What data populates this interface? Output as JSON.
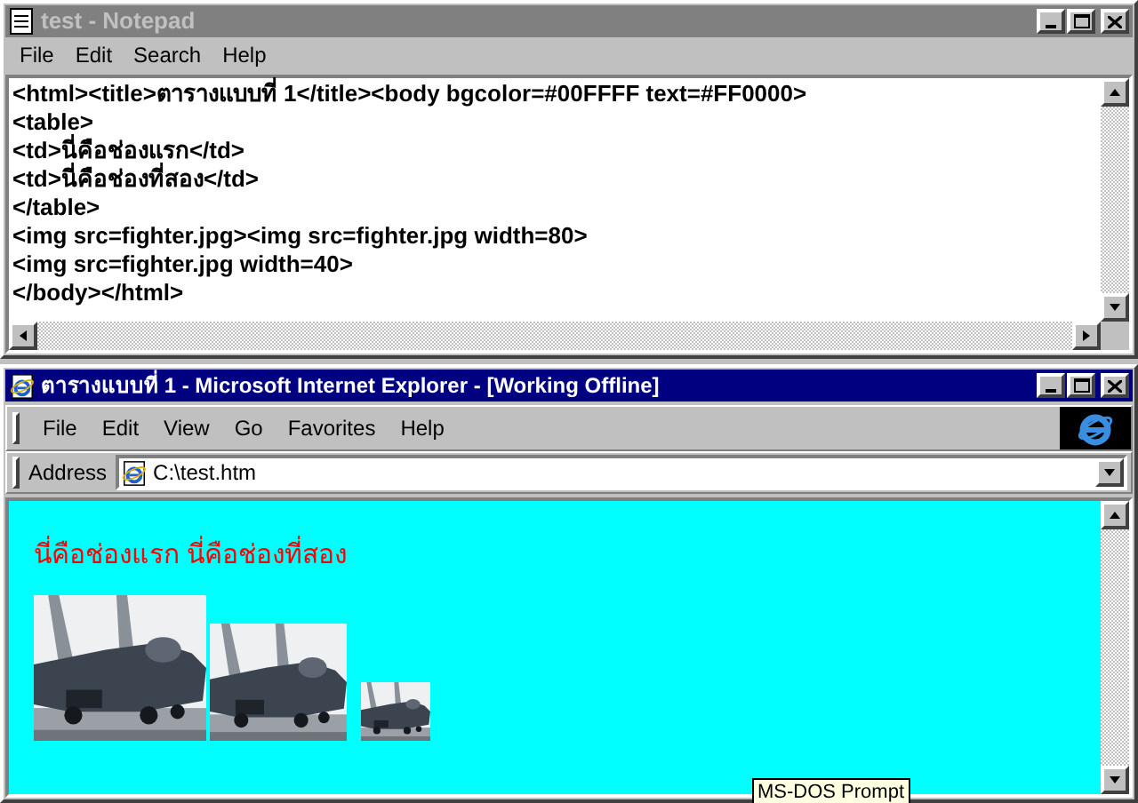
{
  "notepad": {
    "title": "test - Notepad",
    "menu": [
      "File",
      "Edit",
      "Search",
      "Help"
    ],
    "lines": [
      "<html><title>ตารางแบบที่ 1</title><body bgcolor=#00FFFF text=#FF0000>",
      "<table>",
      "<td>นี่คือช่องแรก</td>",
      "<td>นี่คือช่องที่สอง</td>",
      "</table>",
      "<img src=fighter.jpg><img src=fighter.jpg width=80>",
      "<img src=fighter.jpg width=40>",
      "</body></html>"
    ]
  },
  "browser": {
    "title": "ตารางแบบที่ 1 - Microsoft Internet Explorer - [Working Offline]",
    "menu": [
      "File",
      "Edit",
      "View",
      "Go",
      "Favorites",
      "Help"
    ],
    "address_label": "Address",
    "address": "C:\\test.htm",
    "page_text": "นี่คือช่องแรก นี่คือช่องที่สอง"
  },
  "tooltip": "MS-DOS Prompt"
}
